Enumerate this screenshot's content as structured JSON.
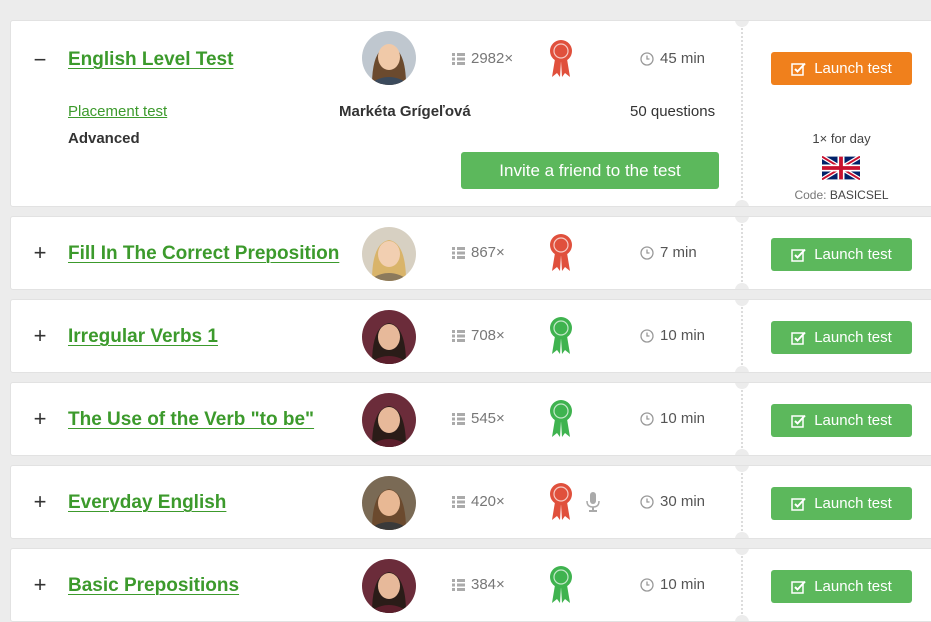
{
  "expanded": {
    "toggle": "−",
    "title": "English Level Test",
    "category": "Placement test",
    "level": "Advanced",
    "author": "Markéta Grígeľová",
    "attempts": "2982×",
    "duration": "45 min",
    "questions": "50 questions",
    "badge_color": "#e0503c",
    "launch_label": "Launch test",
    "launch_color": "#f0801c",
    "invite_label": "Invite a friend to the test",
    "per_day": "1× for day",
    "flag_icon": "uk-flag-icon",
    "code_label": "Code:",
    "code_value": "BASICSEL"
  },
  "tests": [
    {
      "toggle": "+",
      "title": "Fill In The Correct Preposition",
      "attempts": "867×",
      "duration": "7 min",
      "badge_color": "#e0503c",
      "avatar": "blonde-woman",
      "audio": false,
      "launch_label": "Launch test"
    },
    {
      "toggle": "+",
      "title": "Irregular Verbs 1",
      "attempts": "708×",
      "duration": "10 min",
      "badge_color": "#3fb34f",
      "avatar": "dark-hair-woman",
      "audio": false,
      "launch_label": "Launch test"
    },
    {
      "toggle": "+",
      "title": "The Use of the Verb \"to be\"",
      "attempts": "545×",
      "duration": "10 min",
      "badge_color": "#3fb34f",
      "avatar": "dark-hair-woman",
      "audio": false,
      "launch_label": "Launch test"
    },
    {
      "toggle": "+",
      "title": "Everyday English",
      "attempts": "420×",
      "duration": "30 min",
      "badge_color": "#e0503c",
      "avatar": "man",
      "audio": true,
      "launch_label": "Launch test"
    },
    {
      "toggle": "+",
      "title": "Basic Prepositions",
      "attempts": "384×",
      "duration": "10 min",
      "badge_color": "#3fb34f",
      "avatar": "dark-hair-woman",
      "audio": false,
      "launch_label": "Launch test"
    }
  ],
  "colors": {
    "link_green": "#3c9a2c",
    "button_green": "#5cb85c",
    "button_orange": "#f0801c"
  },
  "icons": {
    "expand": "plus-icon",
    "collapse": "minus-icon",
    "attempts": "list-icon",
    "duration": "clock-icon",
    "badge": "award-ribbon-icon",
    "audio": "microphone-icon",
    "launch": "checkbox-edit-icon"
  }
}
